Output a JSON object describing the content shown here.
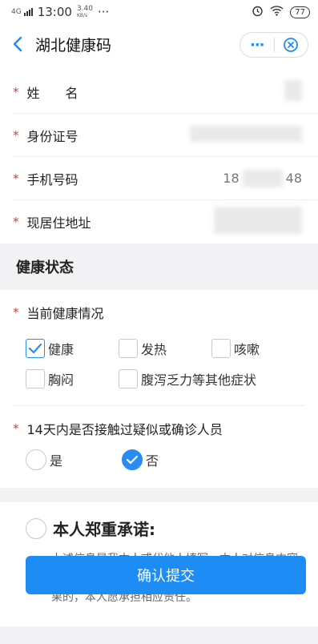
{
  "status_bar": {
    "time": "13:00",
    "signal": "4G",
    "speed_value": "3.40",
    "speed_unit": "KB/s",
    "dots": "···",
    "battery": "77"
  },
  "nav": {
    "title": "湖北健康码",
    "more": "···"
  },
  "basic_info": {
    "rows": [
      {
        "label": "姓　　名",
        "value": ""
      },
      {
        "label": "身份证号",
        "value": ""
      },
      {
        "label": "手机号码",
        "value_start": "18",
        "value_end": "48"
      },
      {
        "label": "现居住地址",
        "value": ""
      }
    ],
    "required_mark": "*"
  },
  "health": {
    "section_title": "健康状态",
    "question1": "当前健康情况",
    "options": [
      {
        "label": "健康",
        "checked": true
      },
      {
        "label": "发热",
        "checked": false
      },
      {
        "label": "咳嗽",
        "checked": false
      },
      {
        "label": "胸闷",
        "checked": false
      },
      {
        "label": "腹泻乏力等其他症状",
        "checked": false
      }
    ],
    "question2": "14天内是否接触过疑似或确诊人员",
    "radios": [
      {
        "label": "是",
        "selected": false
      },
      {
        "label": "否",
        "selected": true
      }
    ]
  },
  "promise": {
    "title": "本人郑重承诺:",
    "text": "上述信息是我本人或代他人填写，本人对信息内容真实性和完整性负责，因信息填报不实导致相关后果的，本人愿承担相应责任。"
  },
  "submit_label": "确认提交",
  "colors": {
    "accent": "#1e8cf5",
    "required": "#e53935"
  }
}
